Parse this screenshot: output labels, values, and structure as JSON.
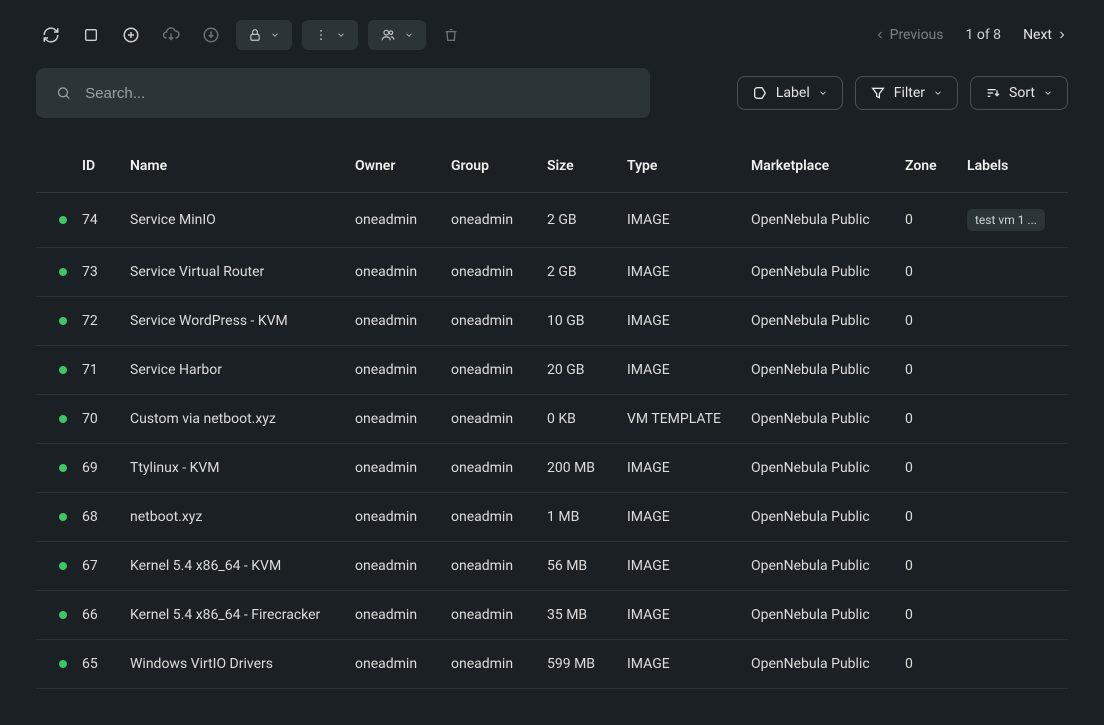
{
  "toolbar": {
    "label_btn": "Label",
    "filter_btn": "Filter",
    "sort_btn": "Sort"
  },
  "pager": {
    "prev": "Previous",
    "count": "1 of 8",
    "next": "Next"
  },
  "search": {
    "placeholder": "Search..."
  },
  "columns": {
    "id": "ID",
    "name": "Name",
    "owner": "Owner",
    "group": "Group",
    "size": "Size",
    "type": "Type",
    "marketplace": "Marketplace",
    "zone": "Zone",
    "labels": "Labels"
  },
  "rows": [
    {
      "id": "74",
      "name": "Service MinIO",
      "owner": "oneadmin",
      "group": "oneadmin",
      "size": "2 GB",
      "type": "IMAGE",
      "marketplace": "OpenNebula Public",
      "zone": "0",
      "labels": "test vm 1 ..."
    },
    {
      "id": "73",
      "name": "Service Virtual Router",
      "owner": "oneadmin",
      "group": "oneadmin",
      "size": "2 GB",
      "type": "IMAGE",
      "marketplace": "OpenNebula Public",
      "zone": "0",
      "labels": ""
    },
    {
      "id": "72",
      "name": "Service WordPress - KVM",
      "owner": "oneadmin",
      "group": "oneadmin",
      "size": "10 GB",
      "type": "IMAGE",
      "marketplace": "OpenNebula Public",
      "zone": "0",
      "labels": ""
    },
    {
      "id": "71",
      "name": "Service Harbor",
      "owner": "oneadmin",
      "group": "oneadmin",
      "size": "20 GB",
      "type": "IMAGE",
      "marketplace": "OpenNebula Public",
      "zone": "0",
      "labels": ""
    },
    {
      "id": "70",
      "name": "Custom via netboot.xyz",
      "owner": "oneadmin",
      "group": "oneadmin",
      "size": "0 KB",
      "type": "VM TEMPLATE",
      "marketplace": "OpenNebula Public",
      "zone": "0",
      "labels": ""
    },
    {
      "id": "69",
      "name": "Ttylinux - KVM",
      "owner": "oneadmin",
      "group": "oneadmin",
      "size": "200 MB",
      "type": "IMAGE",
      "marketplace": "OpenNebula Public",
      "zone": "0",
      "labels": ""
    },
    {
      "id": "68",
      "name": "netboot.xyz",
      "owner": "oneadmin",
      "group": "oneadmin",
      "size": "1 MB",
      "type": "IMAGE",
      "marketplace": "OpenNebula Public",
      "zone": "0",
      "labels": ""
    },
    {
      "id": "67",
      "name": "Kernel 5.4 x86_64 - KVM",
      "owner": "oneadmin",
      "group": "oneadmin",
      "size": "56 MB",
      "type": "IMAGE",
      "marketplace": "OpenNebula Public",
      "zone": "0",
      "labels": ""
    },
    {
      "id": "66",
      "name": "Kernel 5.4 x86_64 - Firecracker",
      "owner": "oneadmin",
      "group": "oneadmin",
      "size": "35 MB",
      "type": "IMAGE",
      "marketplace": "OpenNebula Public",
      "zone": "0",
      "labels": ""
    },
    {
      "id": "65",
      "name": "Windows VirtIO Drivers",
      "owner": "oneadmin",
      "group": "oneadmin",
      "size": "599 MB",
      "type": "IMAGE",
      "marketplace": "OpenNebula Public",
      "zone": "0",
      "labels": ""
    }
  ]
}
